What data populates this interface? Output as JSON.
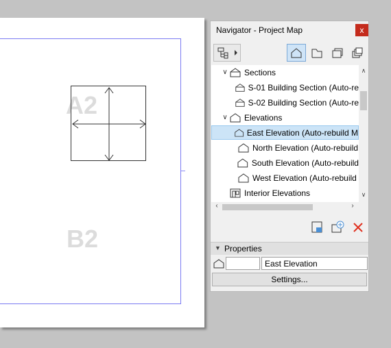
{
  "sheet": {
    "drawing_labels": [
      "A2",
      "B2"
    ]
  },
  "navigator": {
    "title": "Navigator - Project Map",
    "close_glyph": "x",
    "toolbar": {
      "dropdown_icon": "project-tree-icon",
      "map_buttons": [
        "project-map-icon",
        "view-map-icon",
        "layout-book-icon",
        "publisher-sets-icon"
      ]
    },
    "tree": [
      {
        "label": "Sections",
        "twisty": "open",
        "icon": "section-folder-icon",
        "indent": 1
      },
      {
        "label": "S-01 Building Section (Auto-re",
        "icon": "section-icon",
        "indent": 2
      },
      {
        "label": "S-02 Building Section (Auto-re",
        "icon": "section-icon",
        "indent": 2
      },
      {
        "label": "Elevations",
        "twisty": "open",
        "icon": "elevation-folder-icon",
        "indent": 1
      },
      {
        "label": "East Elevation (Auto-rebuild M",
        "icon": "elevation-icon",
        "indent": 2,
        "selected": true
      },
      {
        "label": "North Elevation (Auto-rebuild",
        "icon": "elevation-icon",
        "indent": 2
      },
      {
        "label": "South Elevation (Auto-rebuild",
        "icon": "elevation-icon",
        "indent": 2
      },
      {
        "label": "West Elevation (Auto-rebuild",
        "icon": "elevation-icon",
        "indent": 2
      },
      {
        "label": "Interior Elevations",
        "icon": "interior-elevation-icon",
        "indent": 1
      }
    ],
    "bottom_actions": [
      "open-view-settings-icon",
      "new-view-icon",
      "delete-icon"
    ],
    "properties": {
      "header": "Properties",
      "id_value": "",
      "name_value": "East Elevation",
      "settings_label": "Settings..."
    }
  },
  "colors": {
    "background": "#c3c3c3",
    "frame": "#7b7bf2",
    "selection": "#cce4f7",
    "close": "#c42b1c",
    "delete": "#e0301e"
  }
}
